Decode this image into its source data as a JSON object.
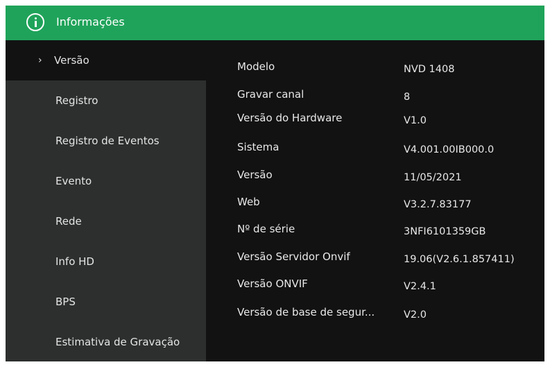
{
  "window": {
    "title": "Informações",
    "icon": "info-icon"
  },
  "sidebar": {
    "active_marker": "›",
    "items": [
      {
        "label": "Versão",
        "active": true
      },
      {
        "label": "Registro",
        "active": false
      },
      {
        "label": "Registro de Eventos",
        "active": false
      },
      {
        "label": "Evento",
        "active": false
      },
      {
        "label": "Rede",
        "active": false
      },
      {
        "label": "Info HD",
        "active": false
      },
      {
        "label": "BPS",
        "active": false
      },
      {
        "label": "Estimativa de Gravação",
        "active": false
      }
    ]
  },
  "info": {
    "rows": [
      {
        "key": "Modelo",
        "value": "NVD 1408"
      },
      {
        "key": "Gravar canal",
        "value": "8"
      },
      {
        "key": "Versão do Hardware",
        "value": "V1.0"
      },
      {
        "key": "Sistema",
        "value": "V4.001.00IB000.0"
      },
      {
        "key": "Versão",
        "value": "11/05/2021"
      },
      {
        "key": "Web",
        "value": "V3.2.7.83177"
      },
      {
        "key": "Nº de série",
        "value": "3NFI6101359GB"
      },
      {
        "key": "Versão Servidor Onvif",
        "value": "19.06(V2.6.1.857411)"
      },
      {
        "key": "Versão ONVIF",
        "value": "V2.4.1"
      },
      {
        "key": "Versão de base de segur...",
        "value": "V2.0"
      }
    ]
  },
  "colors": {
    "titlebar": "#1fa35a",
    "sidebar": "#2d2f2f",
    "content": "#121212",
    "text": "#e8e8e8"
  }
}
